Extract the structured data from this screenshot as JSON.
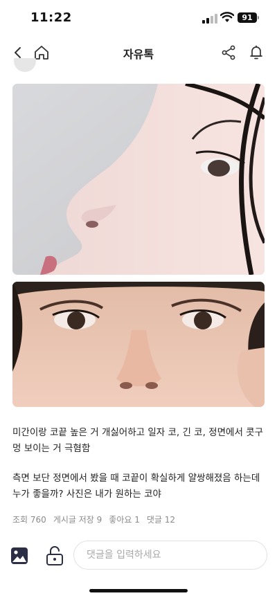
{
  "status": {
    "time": "11:22",
    "battery": "91"
  },
  "nav": {
    "title": "자유톡",
    "back_icon": "chevron-left-icon",
    "home_icon": "home-icon",
    "share_icon": "share-icon",
    "bell_icon": "bell-icon"
  },
  "post": {
    "paragraph1": "미간이랑 코끝 높은 거 개싫어하고 일자 코, 긴 코, 정면에서 콧구멍 보이는 거 극혐함",
    "paragraph2": "측면 보단 정면에서 봤을 때 코끝이 확실하게 얄쌍해졌음 하는데 누가 좋을까? 사진은 내가 원하는 코야"
  },
  "stats": {
    "views": "조회 760",
    "saves": "게시글 저장 9",
    "likes": "좋아요 1",
    "comments": "댓글 12"
  },
  "comment": {
    "placeholder": "댓글을 입력하세요",
    "image_icon": "image-icon",
    "lock_icon": "unlock-icon"
  }
}
